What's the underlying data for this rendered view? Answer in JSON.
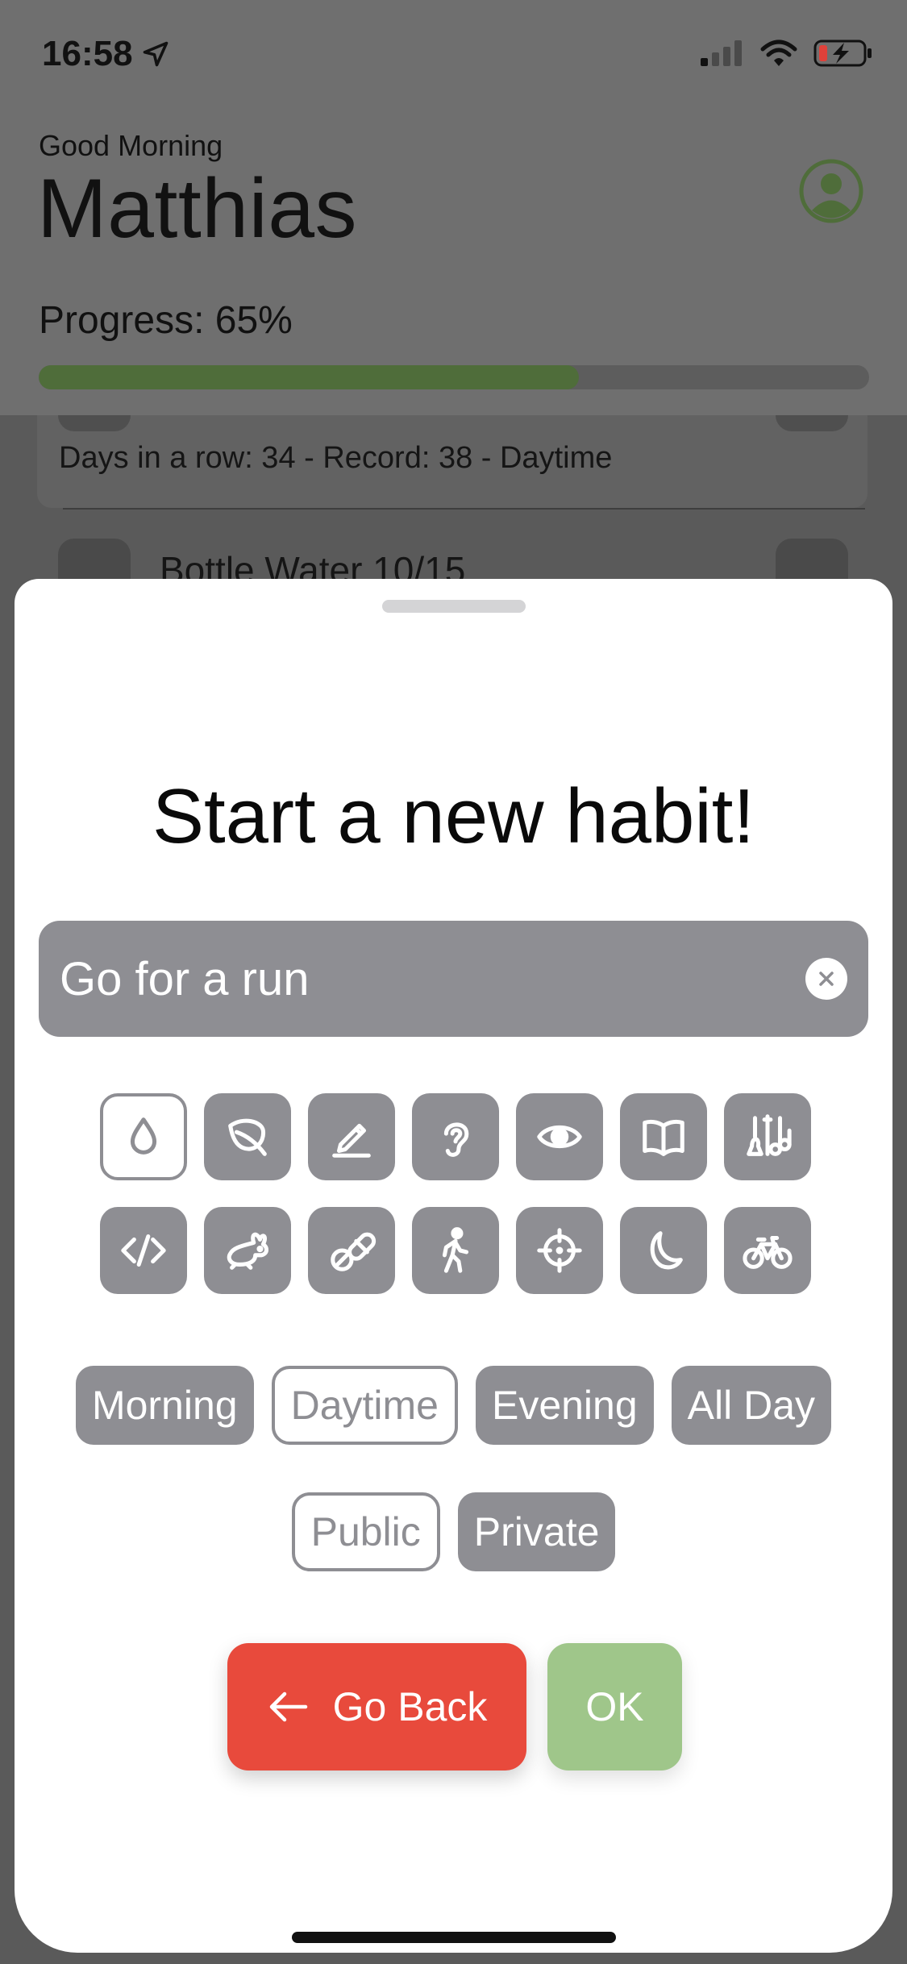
{
  "status_bar": {
    "time": "16:58"
  },
  "header": {
    "greeting": "Good Morning",
    "user_name": "Matthias",
    "progress_label": "Progress: 65%",
    "progress_fraction": 0.65,
    "progress_color": "#4f6d3a"
  },
  "background_list": {
    "habit_stats": "Days in a row: 34 - Record: 38 - Daytime",
    "next_habit_title": "Bottle Water 10/15"
  },
  "sheet": {
    "title": "Start a new habit!",
    "name_input": {
      "value": "Go for a run"
    },
    "icons": [
      {
        "name": "water-drop",
        "selected": true
      },
      {
        "name": "leaf",
        "selected": false
      },
      {
        "name": "pencil",
        "selected": false
      },
      {
        "name": "ear",
        "selected": false
      },
      {
        "name": "eye",
        "selected": false
      },
      {
        "name": "book",
        "selected": false
      },
      {
        "name": "instruments",
        "selected": false
      },
      {
        "name": "code",
        "selected": false
      },
      {
        "name": "rabbit",
        "selected": false
      },
      {
        "name": "pills",
        "selected": false
      },
      {
        "name": "walking",
        "selected": false
      },
      {
        "name": "target",
        "selected": false
      },
      {
        "name": "moon",
        "selected": false
      },
      {
        "name": "bicycle",
        "selected": false
      }
    ],
    "time_of_day": {
      "options": [
        "Morning",
        "Daytime",
        "Evening",
        "All Day"
      ],
      "selected": "Daytime"
    },
    "visibility": {
      "options": [
        "Public",
        "Private"
      ],
      "selected": "Public"
    },
    "back_label": "Go Back",
    "ok_label": "OK",
    "colors": {
      "accent_gray": "#8e8e93",
      "back_red": "#e84a3c",
      "ok_green": "#9fc68a"
    }
  }
}
